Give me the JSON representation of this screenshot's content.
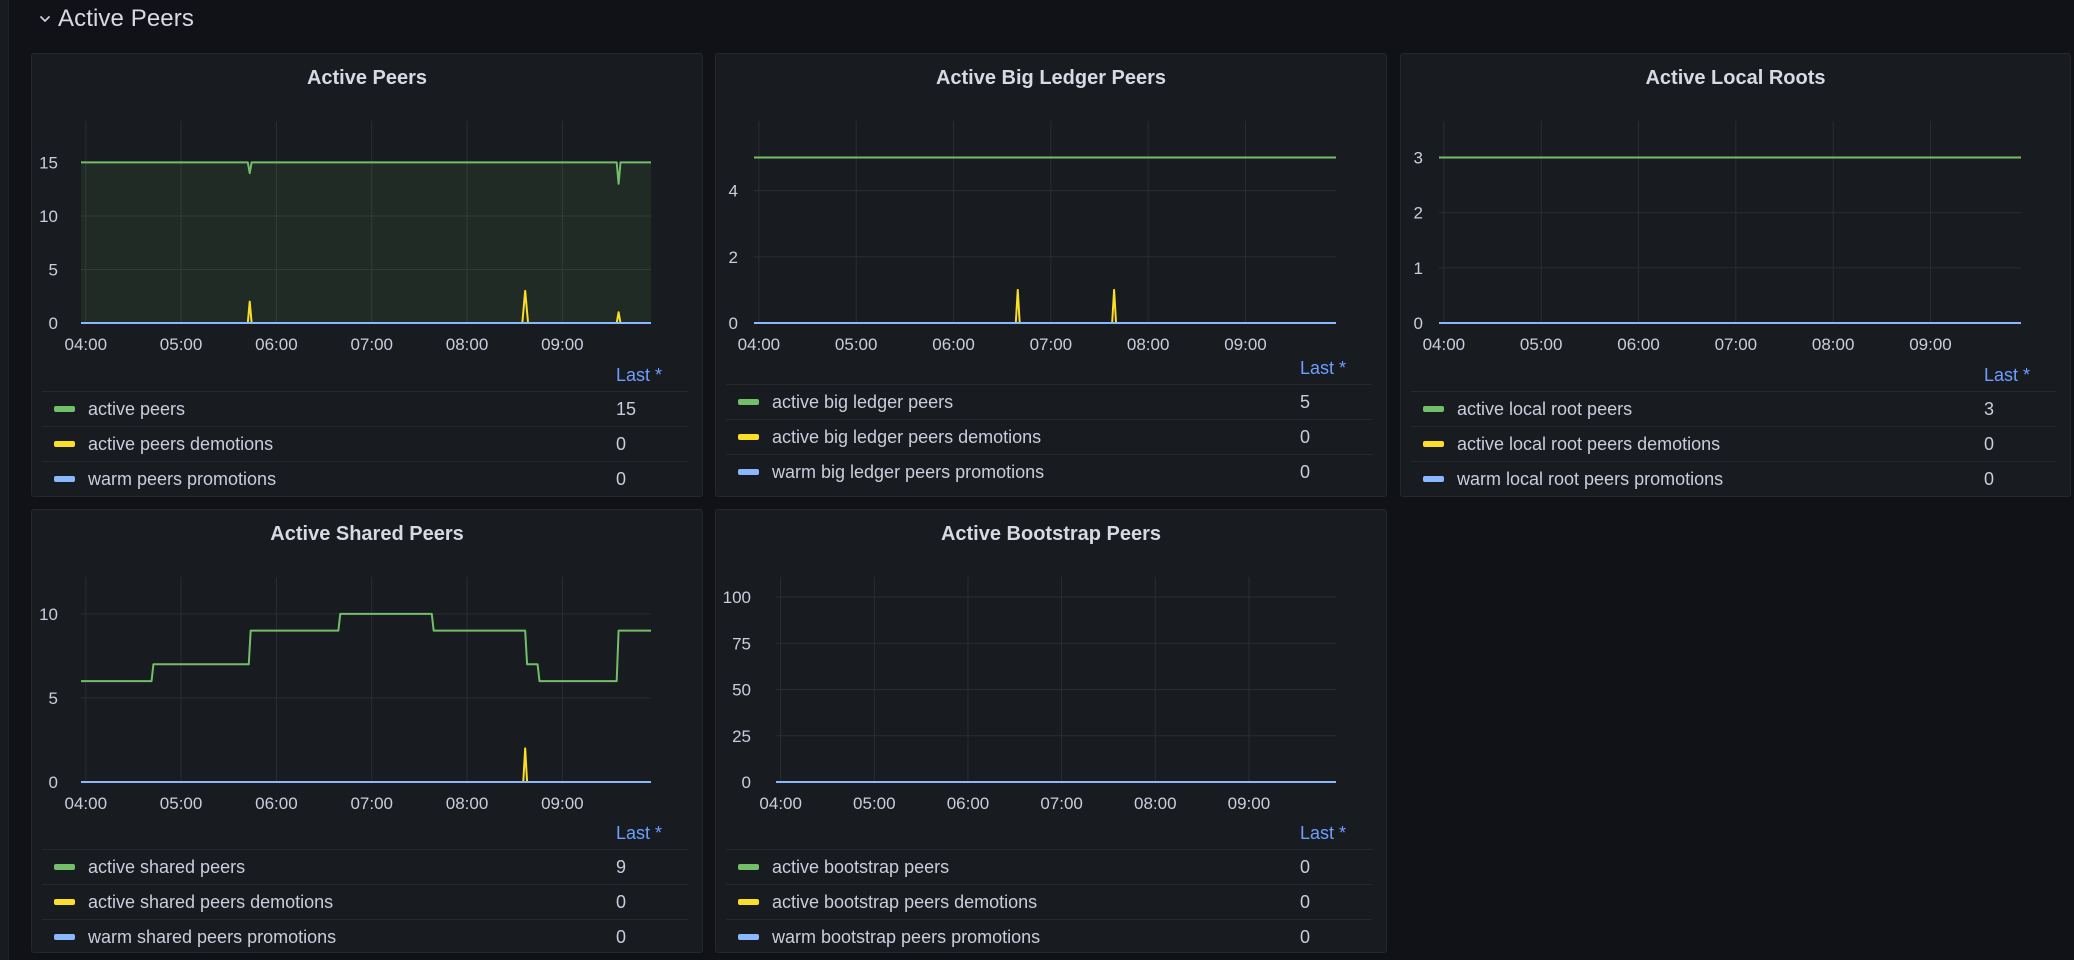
{
  "section": {
    "title": "Active Peers",
    "collapse_icon": "chevron-down-icon"
  },
  "legend_header": "Last *",
  "colors": {
    "green": "#73bf69",
    "yellow": "#fade2a",
    "blue": "#8ab8ff",
    "grid": "#2a2d32",
    "fill_green": "#73bf69"
  },
  "panels": [
    {
      "id": "active-peers",
      "title": "Active Peers",
      "legend": [
        {
          "name": "active peers",
          "color": "#73bf69",
          "last": "15"
        },
        {
          "name": "active peers demotions",
          "color": "#fade2a",
          "last": "0"
        },
        {
          "name": "warm peers promotions",
          "color": "#8ab8ff",
          "last": "0"
        }
      ],
      "chart_data": {
        "type": "line",
        "title": "Active Peers",
        "x_ticks": [
          "04:00",
          "05:00",
          "06:00",
          "07:00",
          "08:00",
          "09:00"
        ],
        "x_range_hours": [
          3.95,
          9.93
        ],
        "y_ticks": [
          0,
          5,
          10,
          15
        ],
        "ylim": [
          0,
          17
        ],
        "fill_first_series": true,
        "series": [
          {
            "name": "active peers",
            "color": "#73bf69",
            "points": [
              [
                3.95,
                15
              ],
              [
                5.7,
                15
              ],
              [
                5.72,
                14
              ],
              [
                5.74,
                15
              ],
              [
                9.57,
                15
              ],
              [
                9.59,
                13
              ],
              [
                9.61,
                15
              ],
              [
                9.93,
                15
              ]
            ]
          },
          {
            "name": "active peers demotions",
            "color": "#fade2a",
            "points": [
              [
                3.95,
                0
              ],
              [
                5.7,
                0
              ],
              [
                5.72,
                2
              ],
              [
                5.74,
                0
              ],
              [
                8.58,
                0
              ],
              [
                8.61,
                3
              ],
              [
                8.64,
                0
              ],
              [
                9.57,
                0
              ],
              [
                9.59,
                1
              ],
              [
                9.61,
                0
              ],
              [
                9.93,
                0
              ]
            ]
          },
          {
            "name": "warm peers promotions",
            "color": "#8ab8ff",
            "points": [
              [
                3.95,
                0
              ],
              [
                9.93,
                0
              ]
            ]
          }
        ]
      }
    },
    {
      "id": "active-big-ledger-peers",
      "title": "Active Big Ledger Peers",
      "legend": [
        {
          "name": "active big ledger peers",
          "color": "#73bf69",
          "last": "5"
        },
        {
          "name": "active big ledger peers demotions",
          "color": "#fade2a",
          "last": "0"
        },
        {
          "name": "warm big ledger peers promotions",
          "color": "#8ab8ff",
          "last": "0"
        }
      ],
      "chart_data": {
        "type": "line",
        "title": "Active Big Ledger Peers",
        "x_ticks": [
          "04:00",
          "05:00",
          "06:00",
          "07:00",
          "08:00",
          "09:00"
        ],
        "x_range_hours": [
          3.95,
          9.93
        ],
        "y_ticks": [
          0,
          2,
          4
        ],
        "ylim": [
          0,
          5.5
        ],
        "fill_first_series": false,
        "series": [
          {
            "name": "active big ledger peers",
            "color": "#73bf69",
            "points": [
              [
                3.95,
                5
              ],
              [
                9.93,
                5
              ]
            ]
          },
          {
            "name": "active big ledger peers demotions",
            "color": "#fade2a",
            "points": [
              [
                3.95,
                0
              ],
              [
                6.64,
                0
              ],
              [
                6.66,
                1
              ],
              [
                6.68,
                0
              ],
              [
                7.63,
                0
              ],
              [
                7.65,
                1
              ],
              [
                7.67,
                0
              ],
              [
                9.93,
                0
              ]
            ]
          },
          {
            "name": "warm big ledger peers promotions",
            "color": "#8ab8ff",
            "points": [
              [
                3.95,
                0
              ],
              [
                9.93,
                0
              ]
            ]
          }
        ]
      }
    },
    {
      "id": "active-local-roots",
      "title": "Active Local Roots",
      "legend": [
        {
          "name": "active local root peers",
          "color": "#73bf69",
          "last": "3"
        },
        {
          "name": "active local root peers demotions",
          "color": "#fade2a",
          "last": "0"
        },
        {
          "name": "warm local root peers promotions",
          "color": "#8ab8ff",
          "last": "0"
        }
      ],
      "chart_data": {
        "type": "line",
        "title": "Active Local Roots",
        "x_ticks": [
          "04:00",
          "05:00",
          "06:00",
          "07:00",
          "08:00",
          "09:00"
        ],
        "x_range_hours": [
          3.95,
          9.93
        ],
        "y_ticks": [
          0,
          1,
          2,
          3
        ],
        "ylim": [
          0,
          3.3
        ],
        "fill_first_series": false,
        "series": [
          {
            "name": "active local root peers",
            "color": "#73bf69",
            "points": [
              [
                3.95,
                3
              ],
              [
                9.93,
                3
              ]
            ]
          },
          {
            "name": "active local root peers demotions",
            "color": "#fade2a",
            "points": [
              [
                3.95,
                0
              ],
              [
                9.93,
                0
              ]
            ]
          },
          {
            "name": "warm local root peers promotions",
            "color": "#8ab8ff",
            "points": [
              [
                3.95,
                0
              ],
              [
                9.93,
                0
              ]
            ]
          }
        ]
      }
    },
    {
      "id": "active-shared-peers",
      "title": "Active Shared Peers",
      "legend": [
        {
          "name": "active shared peers",
          "color": "#73bf69",
          "last": "9"
        },
        {
          "name": "active shared peers demotions",
          "color": "#fade2a",
          "last": "0"
        },
        {
          "name": "warm shared peers promotions",
          "color": "#8ab8ff",
          "last": "0"
        }
      ],
      "chart_data": {
        "type": "line",
        "title": "Active Shared Peers",
        "x_ticks": [
          "04:00",
          "05:00",
          "06:00",
          "07:00",
          "08:00",
          "09:00"
        ],
        "x_range_hours": [
          3.95,
          9.93
        ],
        "y_ticks": [
          0,
          5,
          10
        ],
        "ylim": [
          0,
          11
        ],
        "fill_first_series": false,
        "series": [
          {
            "name": "active shared peers",
            "color": "#73bf69",
            "points": [
              [
                3.95,
                6
              ],
              [
                4.69,
                6
              ],
              [
                4.71,
                7
              ],
              [
                5.71,
                7
              ],
              [
                5.73,
                9
              ],
              [
                6.65,
                9
              ],
              [
                6.67,
                10
              ],
              [
                7.63,
                10
              ],
              [
                7.65,
                9
              ],
              [
                8.61,
                9
              ],
              [
                8.63,
                7
              ],
              [
                8.74,
                7
              ],
              [
                8.76,
                6
              ],
              [
                9.57,
                6
              ],
              [
                9.59,
                9
              ],
              [
                9.93,
                9
              ]
            ]
          },
          {
            "name": "active shared peers demotions",
            "color": "#fade2a",
            "points": [
              [
                3.95,
                0
              ],
              [
                8.59,
                0
              ],
              [
                8.61,
                2
              ],
              [
                8.63,
                0
              ],
              [
                9.93,
                0
              ]
            ]
          },
          {
            "name": "warm shared peers promotions",
            "color": "#8ab8ff",
            "points": [
              [
                3.95,
                0
              ],
              [
                9.93,
                0
              ]
            ]
          }
        ]
      }
    },
    {
      "id": "active-bootstrap-peers",
      "title": "Active Bootstrap Peers",
      "legend": [
        {
          "name": "active bootstrap peers",
          "color": "#73bf69",
          "last": "0"
        },
        {
          "name": "active bootstrap peers demotions",
          "color": "#fade2a",
          "last": "0"
        },
        {
          "name": "warm bootstrap peers promotions",
          "color": "#8ab8ff",
          "last": "0"
        }
      ],
      "chart_data": {
        "type": "line",
        "title": "Active Bootstrap Peers",
        "x_ticks": [
          "04:00",
          "05:00",
          "06:00",
          "07:00",
          "08:00",
          "09:00"
        ],
        "x_range_hours": [
          3.95,
          9.93
        ],
        "y_ticks": [
          0,
          25,
          50,
          75,
          100
        ],
        "ylim": [
          0,
          100
        ],
        "fill_first_series": false,
        "series": [
          {
            "name": "active bootstrap peers",
            "color": "#73bf69",
            "points": [
              [
                3.95,
                0
              ],
              [
                9.93,
                0
              ]
            ]
          },
          {
            "name": "active bootstrap peers demotions",
            "color": "#fade2a",
            "points": [
              [
                3.95,
                0
              ],
              [
                9.93,
                0
              ]
            ]
          },
          {
            "name": "warm bootstrap peers promotions",
            "color": "#8ab8ff",
            "points": [
              [
                3.95,
                0
              ],
              [
                9.93,
                0
              ]
            ]
          }
        ]
      }
    }
  ],
  "chart_data": [
    {
      "ref": "panels.0.chart_data"
    },
    {
      "ref": "panels.1.chart_data"
    },
    {
      "ref": "panels.2.chart_data"
    },
    {
      "ref": "panels.3.chart_data"
    },
    {
      "ref": "panels.4.chart_data"
    }
  ]
}
